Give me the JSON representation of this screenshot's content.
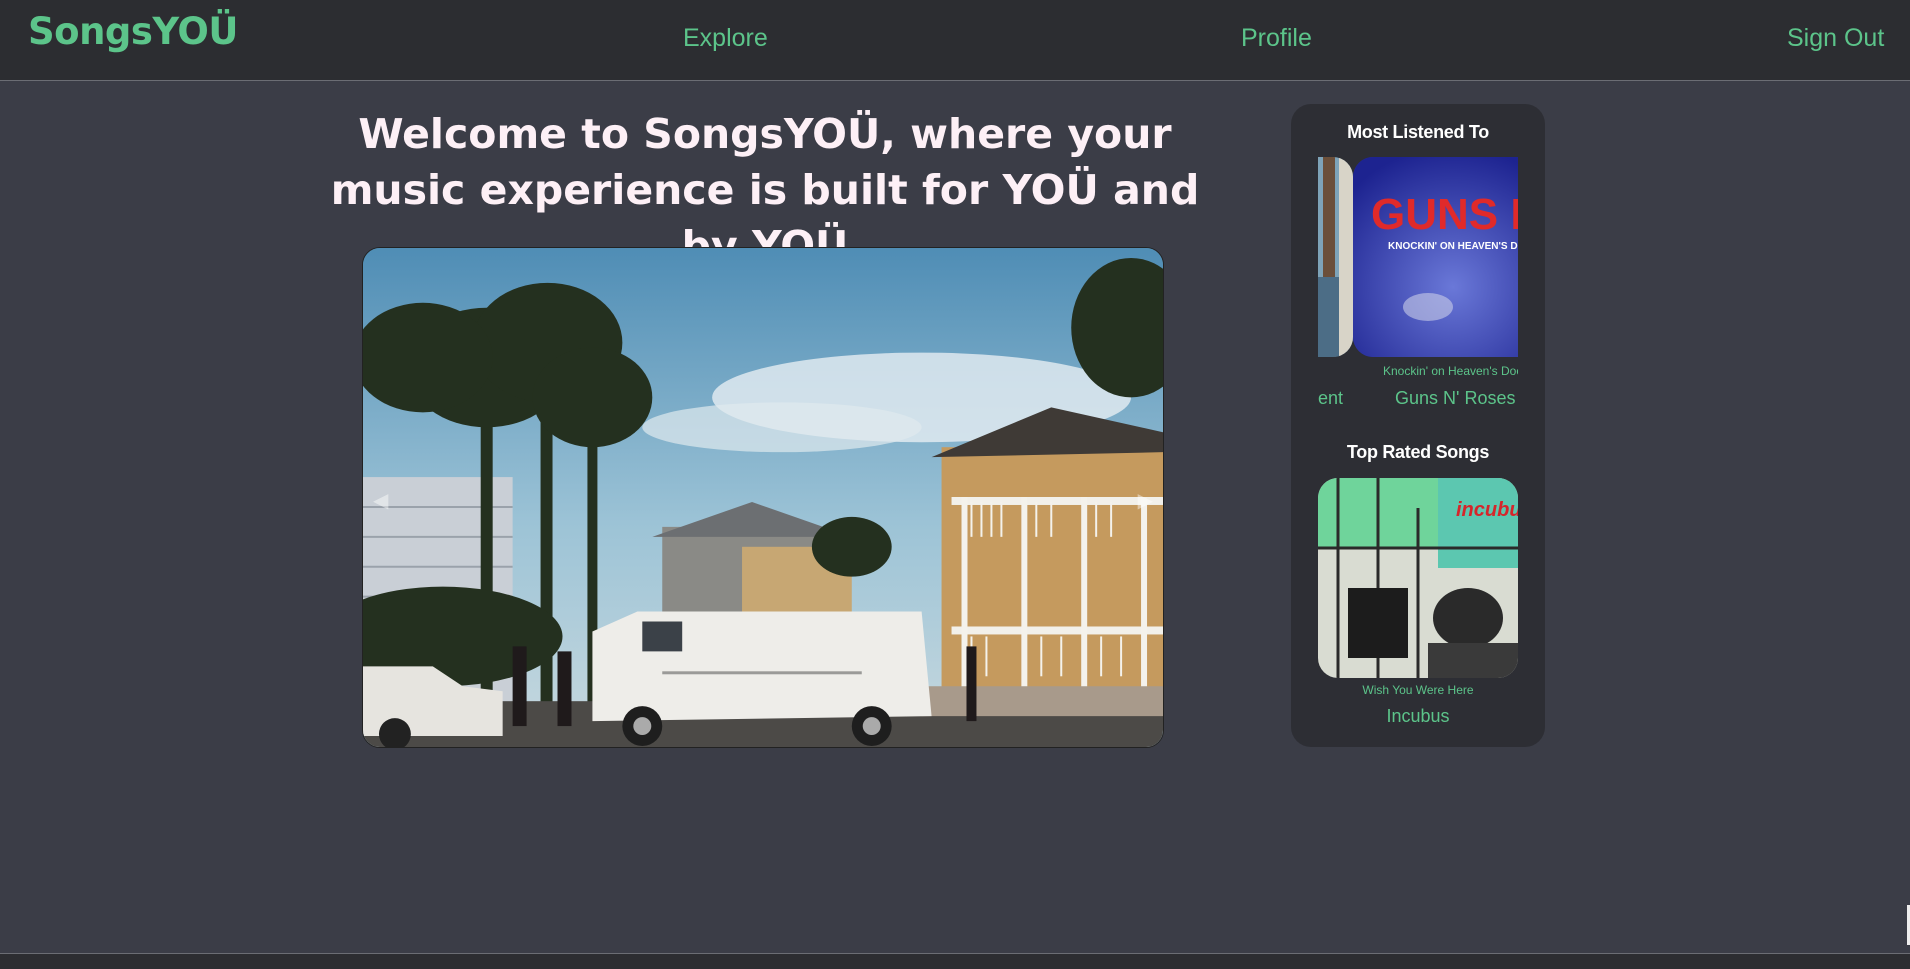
{
  "nav": {
    "brand": "SongsYOÜ",
    "links": [
      "Explore",
      "Profile",
      "Sign Out"
    ]
  },
  "main": {
    "welcome": "Welcome to SongsYOÜ, where your music experience is built for YOÜ and by YOÜ"
  },
  "sidebar": {
    "most_listened": {
      "heading": "Most Listened To",
      "prev_artist_fragment": "ent",
      "current": {
        "song": "Knockin' on Heaven's Doo",
        "artist": "Guns N' Roses",
        "cover_text_top": "GUNS N' ROSE",
        "cover_text_sub": "KNOCKIN' ON HEAVEN'S DOOR"
      }
    },
    "top_rated": {
      "heading": "Top Rated Songs",
      "song": "Wish You Were Here",
      "artist": "Incubus",
      "cover_text": "incubus"
    }
  },
  "colors": {
    "accent": "#5cc48a",
    "background": "#3b3d47",
    "nav_bg": "#2c2d31",
    "card_bg": "#2d2e34",
    "title": "#fdf0f6"
  },
  "icons": {
    "hero_prev": "chevron-left-icon",
    "hero_next": "chevron-right-icon",
    "carousel_next": "chevron-right-icon"
  }
}
